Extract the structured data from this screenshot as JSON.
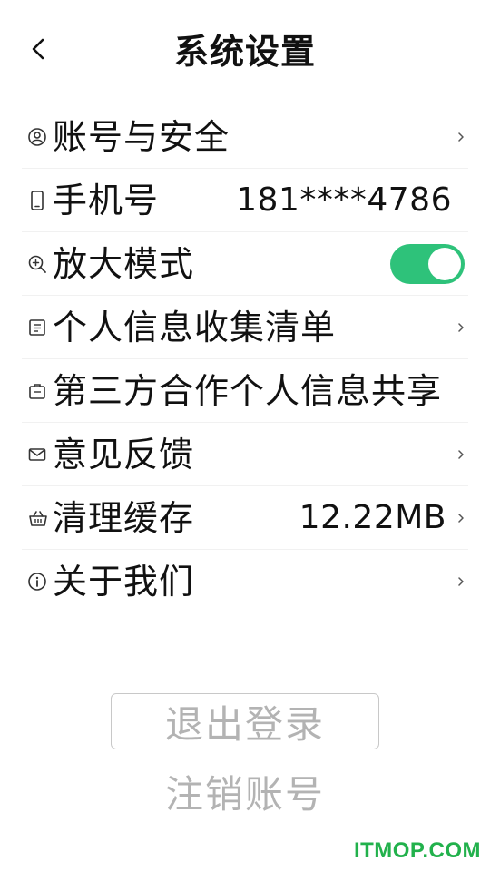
{
  "header": {
    "title": "系统设置"
  },
  "settings": {
    "items": [
      {
        "label": "账号与安全",
        "icon": "account-security-icon"
      },
      {
        "label": "手机号",
        "value": "181****4786",
        "icon": "phone-icon"
      },
      {
        "label": "放大模式",
        "icon": "zoom-icon",
        "toggle_on": true
      },
      {
        "label": "个人信息收集清单",
        "icon": "document-list-icon"
      },
      {
        "label": "第三方合作个人信息共享",
        "icon": "briefcase-icon"
      },
      {
        "label": "意见反馈",
        "icon": "mail-icon"
      },
      {
        "label": "清理缓存",
        "value": "12.22MB",
        "icon": "basket-icon"
      },
      {
        "label": "关于我们",
        "icon": "info-icon"
      }
    ]
  },
  "actions": {
    "logout_label": "退出登录",
    "cancel_account_label": "注销账号"
  },
  "watermark": "ITMOP.COM",
  "colors": {
    "toggle_on": "#2ec27a",
    "muted_text": "#b3b3b3",
    "watermark": "#22b14c"
  }
}
